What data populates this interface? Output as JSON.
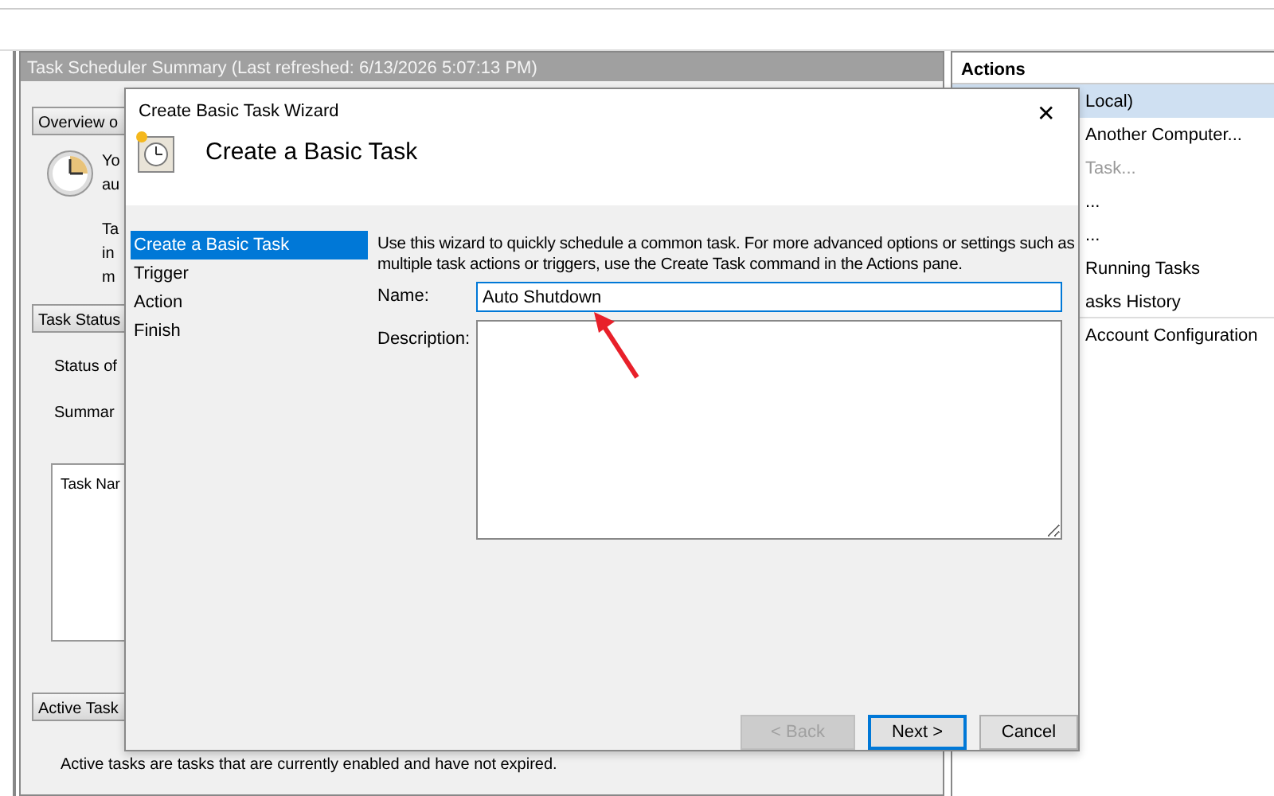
{
  "summary_header": "Task Scheduler Summary (Last refreshed: 6/13/2026 5:07:13 PM)",
  "overview": {
    "header": "Overview o",
    "lines": [
      "Yo",
      "au",
      "Ta",
      "in",
      "m"
    ]
  },
  "task_status": {
    "header": "Task Status",
    "lines": [
      "Status of",
      "Summar"
    ],
    "list_column": "Task Nar"
  },
  "active_tasks": {
    "header": "Active Task",
    "text": "Active tasks are tasks that are currently enabled and have not expired."
  },
  "actions_pane": {
    "title": "Actions",
    "items": [
      {
        "label": "Local)",
        "selected": true,
        "disabled": false
      },
      {
        "label": "Another Computer...",
        "selected": false,
        "disabled": false
      },
      {
        "label": "Task...",
        "selected": false,
        "disabled": true
      },
      {
        "label": "...",
        "selected": false,
        "disabled": false
      },
      {
        "label": "...",
        "selected": false,
        "disabled": false
      },
      {
        "label": "Running Tasks",
        "selected": false,
        "disabled": false
      },
      {
        "label": "asks History",
        "selected": false,
        "disabled": false
      },
      {
        "label": "Account Configuration",
        "selected": false,
        "disabled": false
      }
    ]
  },
  "dialog": {
    "title": "Create Basic Task Wizard",
    "close": "✕",
    "heading": "Create a Basic Task",
    "steps": [
      {
        "label": "Create a Basic Task",
        "selected": true
      },
      {
        "label": "Trigger",
        "selected": false
      },
      {
        "label": "Action",
        "selected": false
      },
      {
        "label": "Finish",
        "selected": false
      }
    ],
    "intro": "Use this wizard to quickly schedule a common task.  For more advanced options or settings such as multiple task actions or triggers, use the Create Task command in the Actions pane.",
    "name_label": "Name:",
    "name_value": "Auto Shutdown",
    "description_label": "Description:",
    "buttons": [
      {
        "label": "< Back",
        "disabled": true,
        "default": false
      },
      {
        "label": "Next >",
        "disabled": false,
        "default": true
      },
      {
        "label": "Cancel",
        "disabled": false,
        "default": false
      }
    ]
  }
}
